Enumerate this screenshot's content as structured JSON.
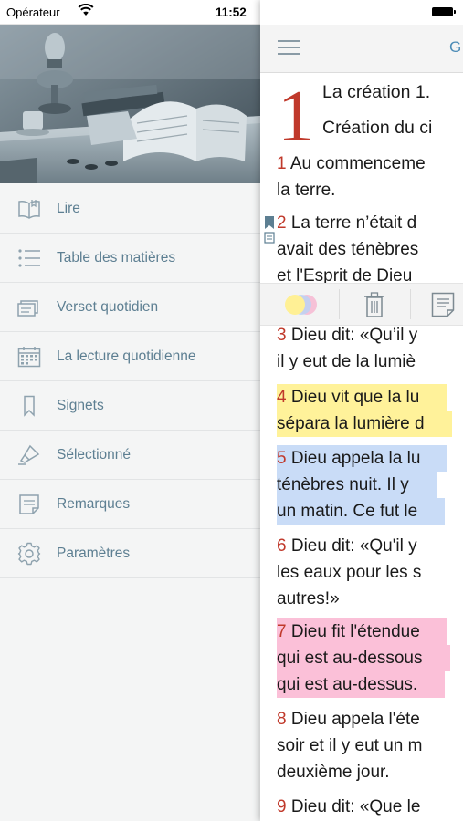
{
  "status": {
    "carrier": "Opérateur",
    "time": "11:52"
  },
  "drawer": {
    "items": [
      {
        "label": "Lire",
        "icon": "open-book-icon"
      },
      {
        "label": "Table des matières",
        "icon": "list-icon"
      },
      {
        "label": "Verset quotidien",
        "icon": "cards-icon"
      },
      {
        "label": "La lecture quotidienne",
        "icon": "calendar-icon"
      },
      {
        "label": "Signets",
        "icon": "bookmark-icon"
      },
      {
        "label": "Sélectionné",
        "icon": "highlighter-icon"
      },
      {
        "label": "Remarques",
        "icon": "note-icon"
      },
      {
        "label": "Paramètres",
        "icon": "gear-icon"
      }
    ]
  },
  "reader": {
    "nav_title": "G",
    "chapter_number": "1",
    "heading1": "La création 1.",
    "heading2": "Création du ci",
    "verses": [
      {
        "num": "1",
        "lines": [
          "Au commenceme",
          "la terre."
        ]
      },
      {
        "num": "2",
        "lines": [
          "La terre n’était d",
          "avait des ténèbres",
          "et l'Esprit de Dieu"
        ]
      },
      {
        "num": "3",
        "lines": [
          "Dieu dit: «Qu’il y",
          "il y eut de la lumiè"
        ]
      },
      {
        "num": "4",
        "lines": [
          "Dieu vit que la lu",
          "sépara la lumière d"
        ],
        "highlight": "#fff29a"
      },
      {
        "num": "5",
        "lines": [
          "Dieu appela la lu",
          "ténèbres nuit. Il y",
          "un matin. Ce fut le"
        ],
        "highlight": "#c9dcf7"
      },
      {
        "num": "6",
        "lines": [
          "Dieu dit: «Qu'il y",
          "les eaux pour les s",
          "autres!»"
        ]
      },
      {
        "num": "7",
        "lines": [
          "Dieu fit l'étendue",
          "qui est au-dessous",
          "qui est au-dessus."
        ],
        "highlight": "#fbc0d8"
      },
      {
        "num": "8",
        "lines": [
          "Dieu appela l'éte",
          "soir et il y eut un m",
          "deuxième jour."
        ]
      },
      {
        "num": "9",
        "lines": [
          "Dieu dit: «Que le"
        ]
      }
    ],
    "toolbar": {
      "color_icon": "color-circles-icon",
      "delete_icon": "trash-icon",
      "note_icon": "note-icon"
    }
  },
  "colors": {
    "menu_text": "#5d7f92",
    "verse_number": "#c0392b",
    "nav_title": "#4b8bb6"
  }
}
